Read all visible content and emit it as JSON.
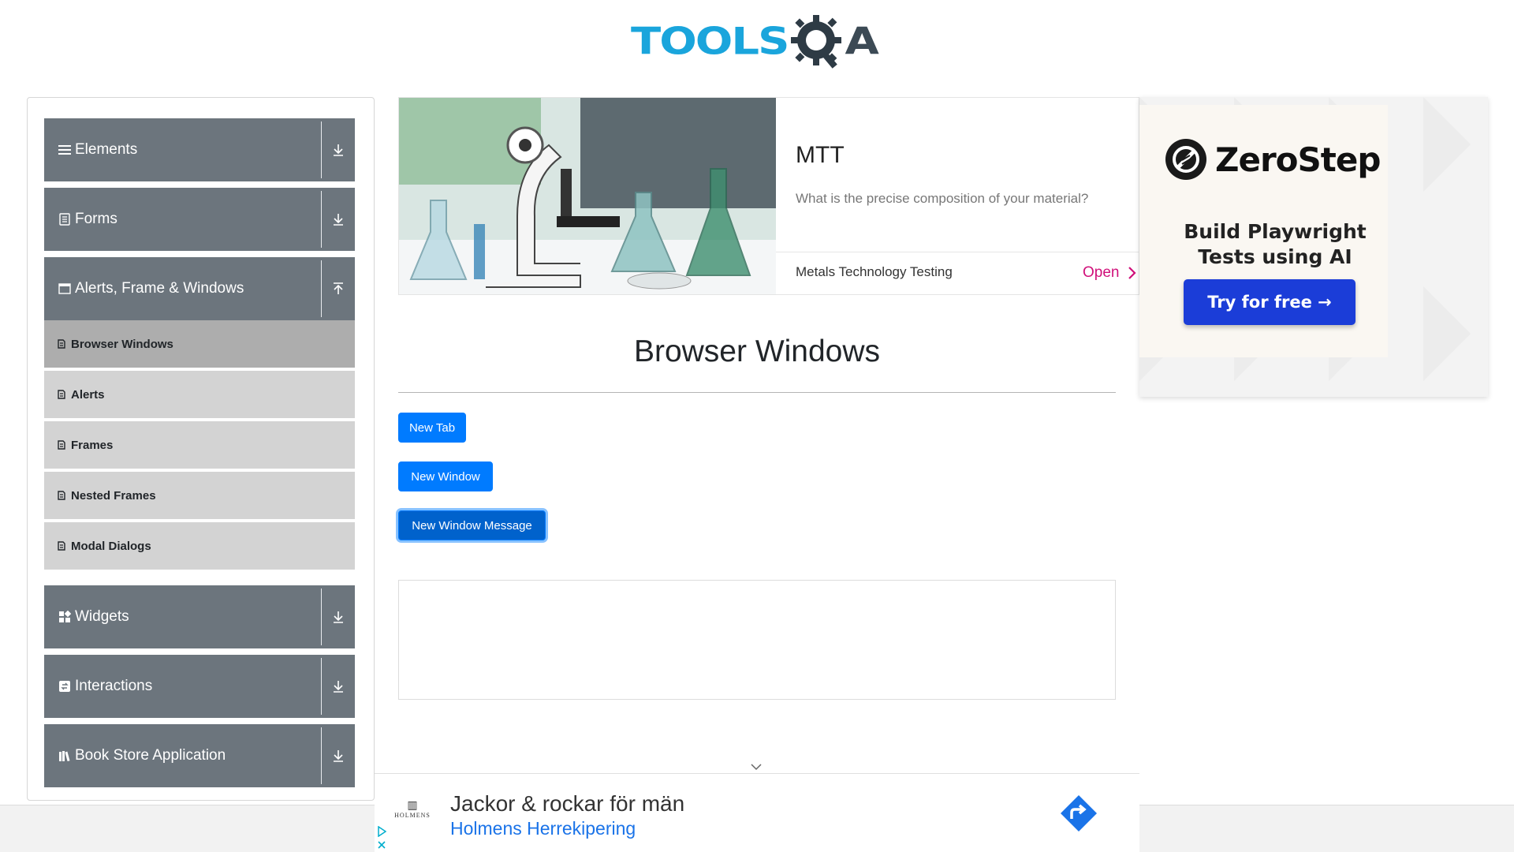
{
  "logo": {
    "part1": "TOOLS",
    "part2": "A"
  },
  "sidebar": {
    "groups": [
      {
        "label": "Elements",
        "icon": "menu-icon",
        "arrow": "download-icon"
      },
      {
        "label": "Forms",
        "icon": "list-icon",
        "arrow": "download-icon"
      },
      {
        "label": "Alerts, Frame & Windows",
        "icon": "window-icon",
        "arrow": "upload-icon"
      },
      {
        "label": "Widgets",
        "icon": "widgets-icon",
        "arrow": "download-icon"
      },
      {
        "label": "Interactions",
        "icon": "interactions-icon",
        "arrow": "download-icon"
      },
      {
        "label": "Book Store Application",
        "icon": "books-icon",
        "arrow": "download-icon"
      }
    ],
    "subitems": [
      {
        "label": "Browser Windows",
        "active": true
      },
      {
        "label": "Alerts",
        "active": false
      },
      {
        "label": "Frames",
        "active": false
      },
      {
        "label": "Nested Frames",
        "active": false
      },
      {
        "label": "Modal Dialogs",
        "active": false
      }
    ]
  },
  "ad_top": {
    "title": "MTT",
    "subtitle": "What is the precise composition of your material?",
    "company": "Metals Technology Testing",
    "cta": "Open"
  },
  "ad_right": {
    "brand": "ZeroStep",
    "tagline_line1": "Build Playwright",
    "tagline_line2": "Tests using AI",
    "button": "Try for free →"
  },
  "main": {
    "title": "Browser Windows",
    "buttons": {
      "new_tab": "New Tab",
      "new_window": "New Window",
      "new_window_message": "New Window Message"
    }
  },
  "ad_bottom": {
    "logo_name": "HOLMENS",
    "title": "Jackor & rockar för män",
    "subtitle": "Holmens Herrekipering"
  },
  "colors": {
    "group_bg": "#6c757d",
    "subitem_bg": "#d3d3d3",
    "subitem_active_bg": "#adadad",
    "primary_button": "#007bff",
    "ad_open": "#d0107a",
    "zerostep_button": "#1b3dd8",
    "logo_blue": "#1aa5dc"
  }
}
